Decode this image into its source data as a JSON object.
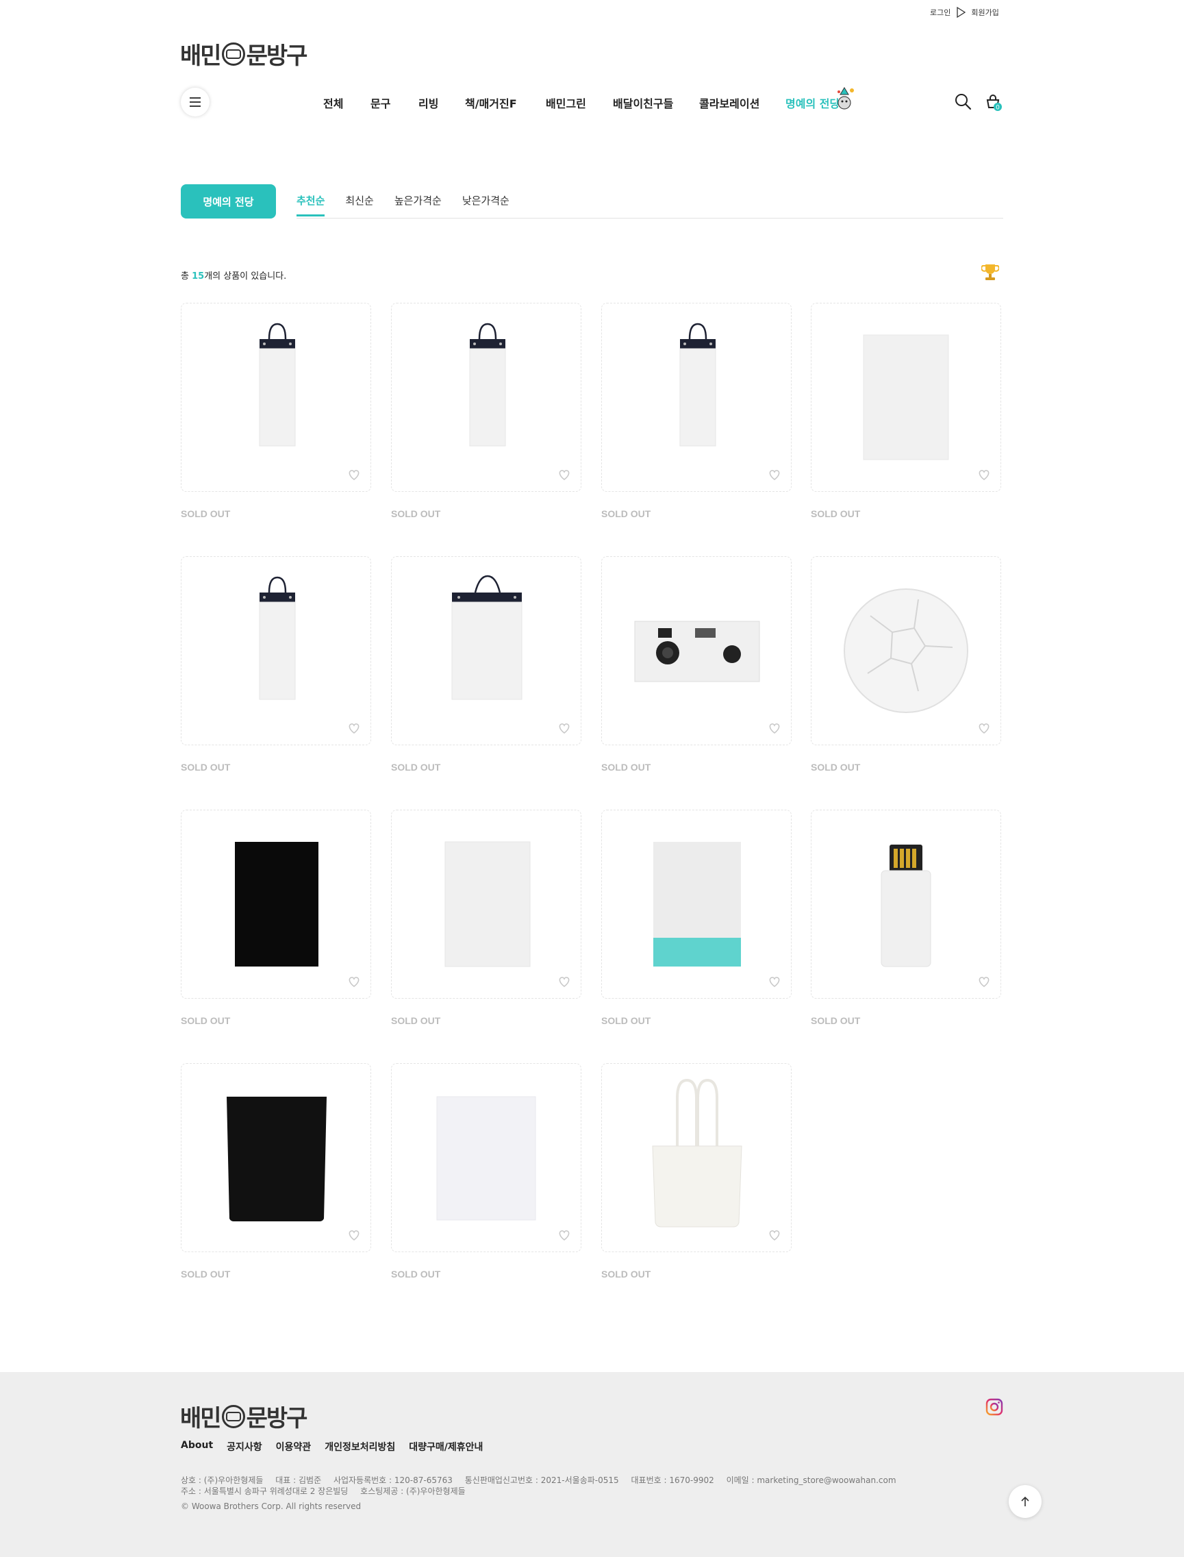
{
  "header": {
    "login": "로그인",
    "signup": "회원가입",
    "logo_left": "배민",
    "logo_right": "문방구",
    "nav": [
      "전체",
      "문구",
      "리빙",
      "책/매거진F",
      "배민그린",
      "배달이친구들",
      "콜라보레이션",
      "명예의 전당"
    ],
    "cart_count": "0"
  },
  "hall": {
    "button": "명예의 전당",
    "sort_tabs": [
      "추천순",
      "최신순",
      "높은가격순",
      "낮은가격순"
    ],
    "active_tab": "추천순"
  },
  "count": {
    "prefix": "총",
    "value": "15",
    "suffix": "개의 상품이 있습니다."
  },
  "products": [
    {
      "image": "narrow-bag-icon",
      "status": "SOLD OUT"
    },
    {
      "image": "narrow-bag-icon",
      "status": "SOLD OUT"
    },
    {
      "image": "narrow-bag-icon",
      "status": "SOLD OUT"
    },
    {
      "image": "white-sheet-icon",
      "status": "SOLD OUT"
    },
    {
      "image": "narrow-bag-icon",
      "status": "SOLD OUT"
    },
    {
      "image": "wide-bag-icon",
      "status": "SOLD OUT"
    },
    {
      "image": "camera-icon",
      "status": "SOLD OUT"
    },
    {
      "image": "soccer-ball-icon",
      "status": "SOLD OUT"
    },
    {
      "image": "black-notebook-icon",
      "status": "SOLD OUT"
    },
    {
      "image": "white-notebook-icon",
      "status": "SOLD OUT"
    },
    {
      "image": "mint-pouch-icon",
      "status": "SOLD OUT"
    },
    {
      "image": "usb-icon",
      "status": "SOLD OUT"
    },
    {
      "image": "black-pouch-icon",
      "status": "SOLD OUT"
    },
    {
      "image": "white-pouch-icon",
      "status": "SOLD OUT"
    },
    {
      "image": "tote-bag-icon",
      "status": "SOLD OUT"
    }
  ],
  "footer": {
    "logo_left": "배민",
    "logo_right": "문방구",
    "links": [
      "About",
      "공지사항",
      "이용약관",
      "개인정보처리방침",
      "대량구매/제휴안내"
    ],
    "info_row1": [
      "상호 : (주)우아한형제들",
      "대표 : 김범준",
      "사업자등록번호 : 120-87-65763",
      "통신판매업신고번호 : 2021-서울송파-0515",
      "대표번호 : 1670-9902",
      "이메일 : marketing_store@woowahan.com"
    ],
    "info_row2": [
      "주소 : 서울특별시 송파구 위례성대로 2 장은빌딩",
      "호스팅제공 : (주)우아한형제들"
    ],
    "copyright": "© Woowa Brothers Corp. All rights reserved"
  },
  "colors": {
    "accent": "#2ac1bc",
    "footer_bg": "#eeeeee",
    "sold_out": "#bcbcbc"
  }
}
